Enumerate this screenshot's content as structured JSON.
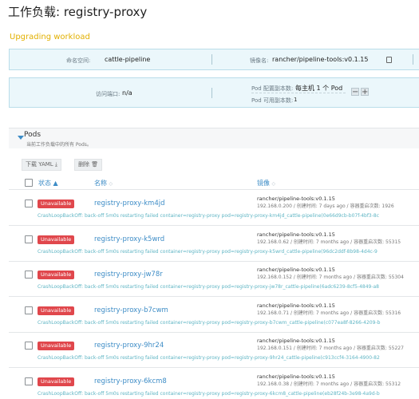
{
  "header": {
    "title": "工作负载: registry-proxy",
    "status": "Upgrading workload"
  },
  "info": {
    "namespace_label": "命名空间:",
    "namespace_value": "cattle-pipeline",
    "image_label": "镜像名:",
    "image_value": "rancher/pipeline-tools:v0.1.15",
    "port_label": "访问端口:",
    "port_value": "n/a",
    "config_label": "Pod 配置副本数:",
    "config_value": "每主机 1 个 Pod",
    "avail_label": "Pod 可用副本数:",
    "avail_value": "1"
  },
  "pods": {
    "title": "Pods",
    "subtitle": "当前工作负载中的所有 Pods。",
    "download_label": "下载 YAML",
    "delete_label": "删除",
    "columns": {
      "status": "状态",
      "name": "名称",
      "image": "镜像"
    }
  },
  "rows": [
    {
      "status": "Unavailable",
      "name": "registry-proxy-km4jd",
      "image": "rancher/pipeline-tools:v0.1.15",
      "ip": "192.168.0.200",
      "created_label": "创建时间:",
      "created": "7 days ago",
      "restarts_label": "容器重启次数:",
      "restarts": "1926",
      "error": "CrashLoopBackOff: back-off 5m0s restarting failed container=registry-proxy pod=registry-proxy-km4jd_cattle-pipeline(0e66d9cb-b07f-4bf3-8c"
    },
    {
      "status": "Unavailable",
      "name": "registry-proxy-k5wrd",
      "image": "rancher/pipeline-tools:v0.1.15",
      "ip": "192.168.0.62",
      "created_label": "创建时间:",
      "created": "7 months ago",
      "restarts_label": "容器重启次数:",
      "restarts": "55315",
      "error": "CrashLoopBackOff: back-off 5m0s restarting failed container=registry-proxy pod=registry-proxy-k5wrd_cattle-pipeline(96dc2ddf-8b98-4d4c-9"
    },
    {
      "status": "Unavailable",
      "name": "registry-proxy-jw78r",
      "image": "rancher/pipeline-tools:v0.1.15",
      "ip": "192.168.0.152",
      "created_label": "创建时间:",
      "created": "7 months ago",
      "restarts_label": "容器重启次数:",
      "restarts": "55304",
      "error": "CrashLoopBackOff: back-off 5m0s restarting failed container=registry-proxy pod=registry-proxy-jw78r_cattle-pipeline(6adc6239-8cf5-4849-a8"
    },
    {
      "status": "Unavailable",
      "name": "registry-proxy-b7cwm",
      "image": "rancher/pipeline-tools:v0.1.15",
      "ip": "192.168.0.71",
      "created_label": "创建时间:",
      "created": "7 months ago",
      "restarts_label": "容器重启次数:",
      "restarts": "55316",
      "error": "CrashLoopBackOff: back-off 5m0s restarting failed container=registry-proxy pod=registry-proxy-b7cwm_cattle-pipeline(c077ea8f-8266-4209-b"
    },
    {
      "status": "Unavailable",
      "name": "registry-proxy-9hr24",
      "image": "rancher/pipeline-tools:v0.1.15",
      "ip": "192.168.0.151",
      "created_label": "创建时间:",
      "created": "7 months ago",
      "restarts_label": "容器重启次数:",
      "restarts": "55227",
      "error": "CrashLoopBackOff: back-off 5m0s restarting failed container=registry-proxy pod=registry-proxy-9hr24_cattle-pipeline(c913ccf4-3164-4900-82"
    },
    {
      "status": "Unavailable",
      "name": "registry-proxy-6kcm8",
      "image": "rancher/pipeline-tools:v0.1.15",
      "ip": "192.168.0.38",
      "created_label": "创建时间:",
      "created": "7 months ago",
      "restarts_label": "容器重启次数:",
      "restarts": "55312",
      "error": "CrashLoopBackOff: back-off 5m0s restarting failed container=registry-proxy pod=registry-proxy-6kcm8_cattle-pipeline(eb28f24b-3e98-4a9d-b"
    }
  ]
}
